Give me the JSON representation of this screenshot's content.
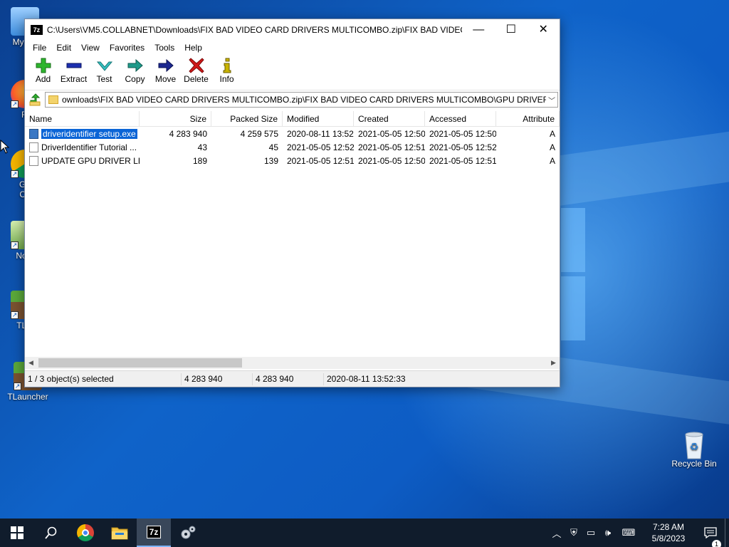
{
  "desktop": {
    "icons_left": [
      {
        "label": "My Co"
      },
      {
        "label": "Fi"
      },
      {
        "label": "Go\nCh"
      },
      {
        "label": "Note"
      },
      {
        "label": "TL L"
      },
      {
        "label": "TLauncher"
      }
    ],
    "recycle_bin": {
      "label": "Recycle Bin"
    }
  },
  "window": {
    "title": "C:\\Users\\VM5.COLLABNET\\Downloads\\FIX BAD VIDEO CARD DRIVERS MULTICOMBO.zip\\FIX BAD VIDEO CA...",
    "app_icon": "7z",
    "controls": {
      "minimize": "—",
      "maximize": "☐",
      "close": "✕"
    },
    "menu": [
      "File",
      "Edit",
      "View",
      "Favorites",
      "Tools",
      "Help"
    ],
    "toolbar": [
      {
        "label": "Add",
        "icon": "plus-icon",
        "color": "#2db52d"
      },
      {
        "label": "Extract",
        "icon": "minus-icon",
        "color": "#1c2fb0"
      },
      {
        "label": "Test",
        "icon": "check-icon",
        "color": "#35c2c2"
      },
      {
        "label": "Copy",
        "icon": "arrow-right-icon",
        "color": "#1f9a8a"
      },
      {
        "label": "Move",
        "icon": "arrow-right-icon",
        "color": "#1c2890"
      },
      {
        "label": "Delete",
        "icon": "x-icon",
        "color": "#d01818"
      },
      {
        "label": "Info",
        "icon": "info-icon",
        "color": "#c9b400"
      }
    ],
    "address": "ownloads\\FIX BAD VIDEO CARD DRIVERS MULTICOMBO.zip\\FIX BAD VIDEO CARD DRIVERS MULTICOMBO\\GPU DRIVER UPDATE\\",
    "columns": [
      "Name",
      "Size",
      "Packed Size",
      "Modified",
      "Created",
      "Accessed",
      "Attribute"
    ],
    "files": [
      {
        "name": "driveridentifier setup.exe",
        "size": "4 283 940",
        "packed": "4 259 575",
        "modified": "2020-08-11 13:52",
        "created": "2021-05-05 12:50",
        "accessed": "2021-05-05 12:50",
        "attr": "A",
        "type": "exe",
        "selected": true
      },
      {
        "name": "DriverIdentifier Tutorial ...",
        "size": "43",
        "packed": "45",
        "modified": "2021-05-05 12:52",
        "created": "2021-05-05 12:51",
        "accessed": "2021-05-05 12:52",
        "attr": "A",
        "type": "doc",
        "selected": false
      },
      {
        "name": "UPDATE GPU DRIVER LI...",
        "size": "189",
        "packed": "139",
        "modified": "2021-05-05 12:51",
        "created": "2021-05-05 12:50",
        "accessed": "2021-05-05 12:51",
        "attr": "A",
        "type": "doc",
        "selected": false
      }
    ],
    "status": {
      "selection": "1 / 3 object(s) selected",
      "size": "4 283 940",
      "packed": "4 283 940",
      "modified": "2020-08-11 13:52:33"
    }
  },
  "taskbar": {
    "items": [
      {
        "name": "start-button",
        "icon": "windows-icon"
      },
      {
        "name": "search-button",
        "icon": "search-icon"
      },
      {
        "name": "chrome-button",
        "icon": "chrome-icon"
      },
      {
        "name": "file-explorer-button",
        "icon": "folder-icon"
      },
      {
        "name": "7zip-button",
        "icon": "7zip-icon",
        "label": "7z",
        "active": true
      },
      {
        "name": "settings-app-button",
        "icon": "gears-icon"
      }
    ],
    "tray": {
      "time": "7:28 AM",
      "date": "5/8/2023",
      "notification_count": "1"
    }
  }
}
